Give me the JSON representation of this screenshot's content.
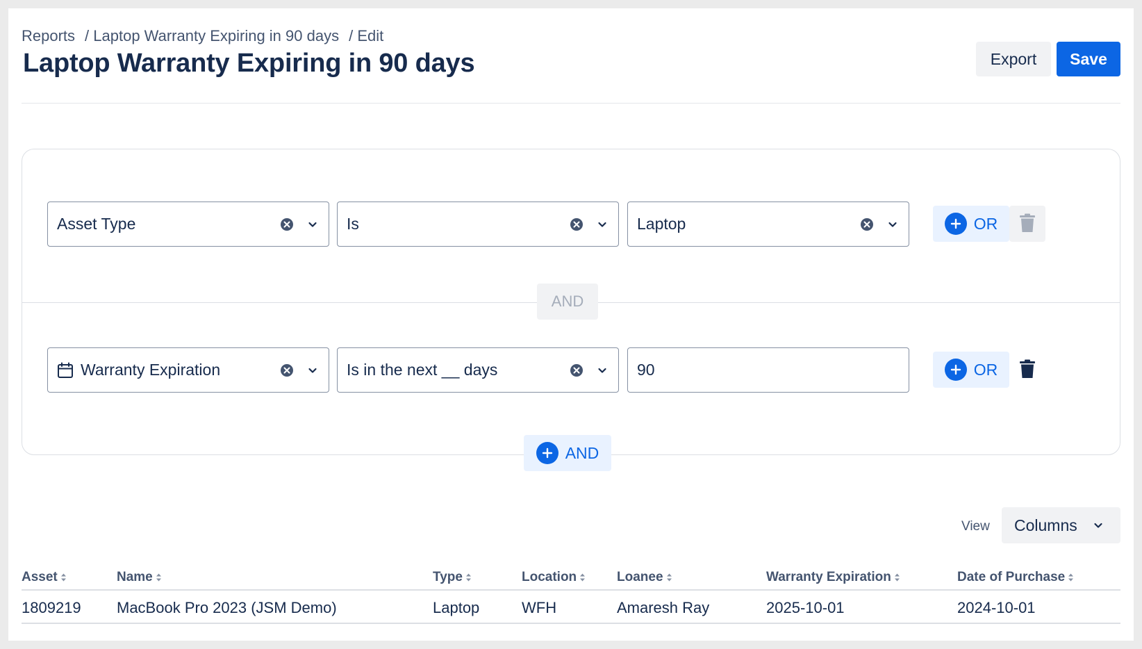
{
  "breadcrumb": {
    "items": [
      "Reports",
      "/ Laptop Warranty Expiring in 90 days",
      "/ Edit"
    ]
  },
  "header": {
    "title": "Laptop Warranty Expiring in 90 days",
    "export_label": "Export",
    "save_label": "Save"
  },
  "filters": {
    "and_separator": "AND",
    "rows": [
      {
        "field": "Asset Type",
        "operator": "Is",
        "value": "Laptop",
        "or_label": "OR",
        "delete_disabled": true
      },
      {
        "field": "Warranty Expiration",
        "field_icon": "calendar-icon",
        "operator": "Is in the next __ days",
        "value": "90",
        "or_label": "OR",
        "delete_disabled": false
      }
    ],
    "add_and_label": "AND"
  },
  "view": {
    "label": "View",
    "columns_label": "Columns"
  },
  "table": {
    "columns": [
      "Asset",
      "Name",
      "Type",
      "Location",
      "Loanee",
      "Warranty Expiration",
      "Date of Purchase"
    ],
    "rows": [
      [
        "1809219",
        "MacBook Pro 2023 (JSM Demo)",
        "Laptop",
        "WFH",
        "Amaresh Ray",
        "2025-10-01",
        "2024-10-01"
      ]
    ]
  },
  "colors": {
    "primary": "#0c66e4",
    "primary_subtle": "#e9f2ff",
    "text": "#172b4d",
    "text_subtle": "#44546f",
    "border": "#8590a2",
    "disabled_text": "#a5adba"
  }
}
